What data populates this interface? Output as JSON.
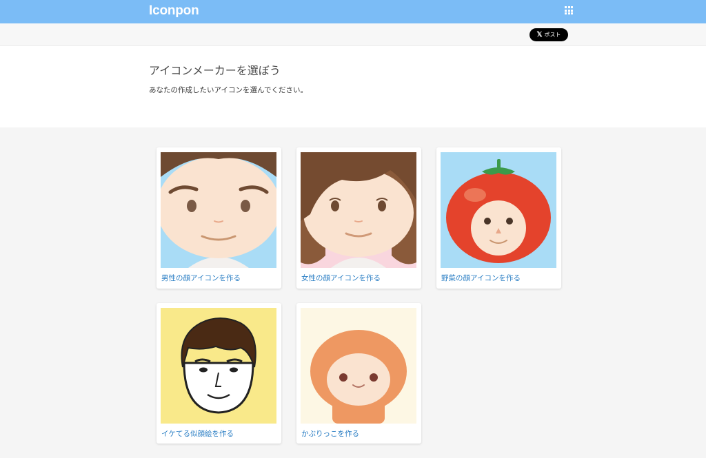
{
  "header": {
    "logo": "Iconpon",
    "apps_icon": "grid-icon"
  },
  "share": {
    "x_glyph": "𝕏",
    "post_label": "ポスト"
  },
  "intro": {
    "title": "アイコンメーカーを選ぼう",
    "description": "あなたの作成したいアイコンを選んでください。"
  },
  "makers": [
    {
      "label": "男性の顔アイコンを作る",
      "image": "male-face-icon"
    },
    {
      "label": "女性の顔アイコンを作る",
      "image": "female-face-icon"
    },
    {
      "label": "野菜の顔アイコンを作る",
      "image": "tomato-face-icon"
    },
    {
      "label": "イケてる似顔絵を作る",
      "image": "portrait-icon"
    },
    {
      "label": "かぶりっこを作る",
      "image": "hood-character-icon"
    }
  ],
  "colors": {
    "header": "#7bbcf6",
    "link": "#2a7ec4",
    "skin": "#fae3d0",
    "hair": "#6e4a32",
    "tomato": "#e4432c",
    "yellow_bg": "#f9e98a",
    "hood": "#ee9862"
  }
}
